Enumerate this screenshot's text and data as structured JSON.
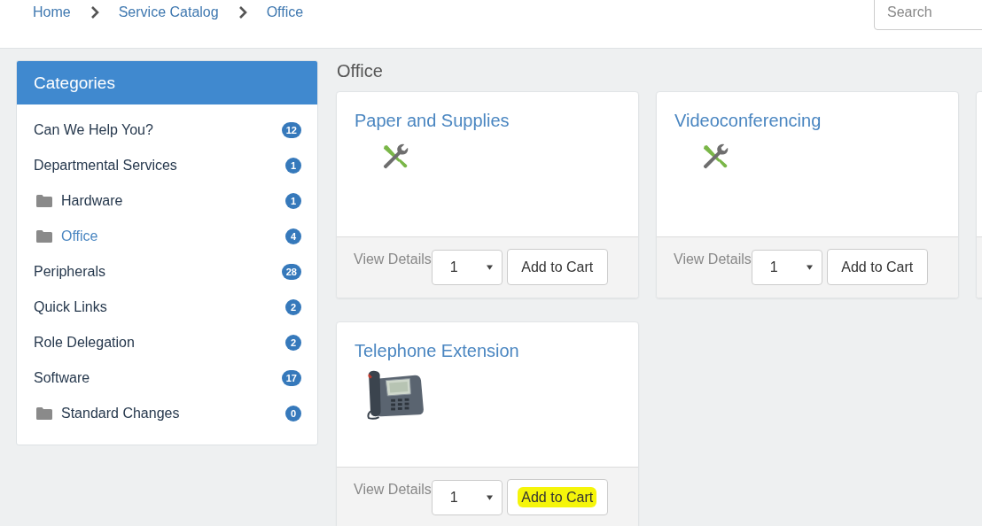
{
  "breadcrumb": [
    {
      "label": "Home"
    },
    {
      "label": "Service Catalog"
    },
    {
      "label": "Office"
    }
  ],
  "search": {
    "placeholder": "Search"
  },
  "sidebar": {
    "title": "Categories",
    "items": [
      {
        "label": "Can We Help You?",
        "count": "12",
        "folder": false,
        "selected": false
      },
      {
        "label": "Departmental Services",
        "count": "1",
        "folder": false,
        "selected": false
      },
      {
        "label": "Hardware",
        "count": "1",
        "folder": true,
        "selected": false
      },
      {
        "label": "Office",
        "count": "4",
        "folder": true,
        "selected": true
      },
      {
        "label": "Peripherals",
        "count": "28",
        "folder": false,
        "selected": false
      },
      {
        "label": "Quick Links",
        "count": "2",
        "folder": false,
        "selected": false
      },
      {
        "label": "Role Delegation",
        "count": "2",
        "folder": false,
        "selected": false
      },
      {
        "label": "Software",
        "count": "17",
        "folder": false,
        "selected": false
      },
      {
        "label": "Standard Changes",
        "count": "0",
        "folder": true,
        "selected": false
      }
    ]
  },
  "page_title": "Office",
  "cards": [
    {
      "title": "Paper and Supplies",
      "kind": "tools",
      "details_link": "View Details",
      "quantity": "1",
      "button": "Add to Cart",
      "highlighted": false
    },
    {
      "title": "Videoconferencing",
      "kind": "tools",
      "details_link": "View Details",
      "quantity": "1",
      "button": "Add to Cart",
      "highlighted": false
    },
    {
      "title": "Telephone Extension",
      "kind": "phone",
      "details_link": "View Details",
      "quantity": "1",
      "button": "Add to Cart",
      "highlighted": true
    }
  ]
}
